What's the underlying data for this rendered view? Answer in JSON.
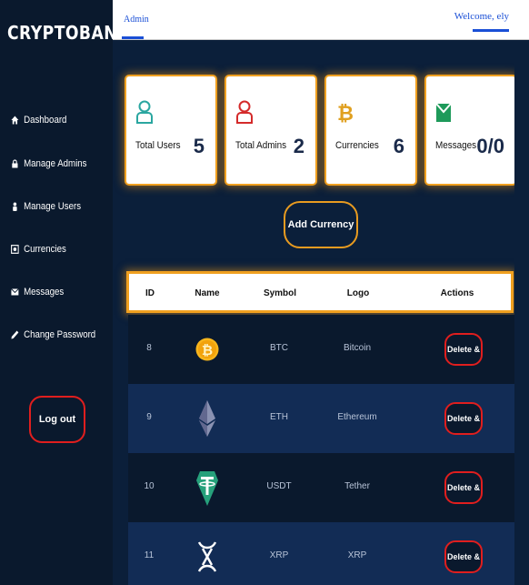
{
  "sidebar": {
    "brand": "CRYPTOBANK",
    "items": [
      {
        "label": "Dashboard",
        "icon": "home-icon"
      },
      {
        "label": "Manage Admins",
        "icon": "lock-icon"
      },
      {
        "label": "Manage Users",
        "icon": "user-icon"
      },
      {
        "label": "Currencies",
        "icon": "currency-icon"
      },
      {
        "label": "Messages",
        "icon": "envelope-icon"
      },
      {
        "label": "Change Password",
        "icon": "pencil-icon"
      }
    ],
    "logout_label": "Log out"
  },
  "topbar": {
    "tab_label": "Admin",
    "welcome": "Welcome, ely"
  },
  "cards": [
    {
      "label": "Total Users",
      "value": "5",
      "icon": "user-outline-icon",
      "icon_color": "#2aa6a0"
    },
    {
      "label": "Total Admins",
      "value": "2",
      "icon": "admin-outline-icon",
      "icon_color": "#d42a2a"
    },
    {
      "label": "Currencies",
      "value": "6",
      "icon": "bitcoin-icon",
      "icon_color": "#e0a020"
    },
    {
      "label": "Messages",
      "value": "0/0",
      "icon": "message-icon",
      "icon_color": "#1e9a5a"
    }
  ],
  "add_currency_label": "Add Currency",
  "table": {
    "headers": [
      "ID",
      "Name",
      "Symbol",
      "Logo",
      "Actions"
    ],
    "rows": [
      {
        "id": "8",
        "symbol": "BTC",
        "logo": "Bitcoin",
        "coin_icon": "bitcoin-coin-icon",
        "action": "Delete"
      },
      {
        "id": "9",
        "symbol": "ETH",
        "logo": "Ethereum",
        "coin_icon": "ethereum-coin-icon",
        "action": "Delete"
      },
      {
        "id": "10",
        "symbol": "USDT",
        "logo": "Tether",
        "coin_icon": "tether-coin-icon",
        "action": "Delete"
      },
      {
        "id": "11",
        "symbol": "XRP",
        "logo": "XRP",
        "coin_icon": "xrp-coin-icon",
        "action": "Delete"
      }
    ]
  },
  "colors": {
    "sidebar_bg": "#0a192d",
    "main_bg": "#0b1f3a",
    "accent_orange": "#f0a020",
    "danger_red": "#e01e1e",
    "link_blue": "#1a4fd6"
  }
}
